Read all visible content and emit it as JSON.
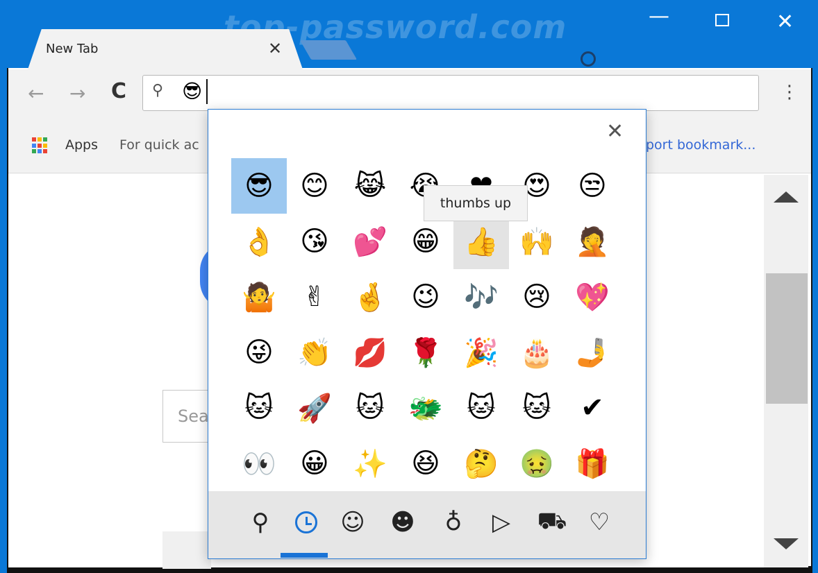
{
  "window": {
    "watermark": "top-password.com",
    "min_glyph": "—",
    "close_glyph": "✕"
  },
  "tab": {
    "title": "New Tab",
    "close_glyph": "✕"
  },
  "toolbar": {
    "back_glyph": "←",
    "forward_glyph": "→",
    "reload_glyph": "C",
    "search_glyph": "⚲",
    "omnibox_value": "😎",
    "menu_glyph": "⋮"
  },
  "bookmarks": {
    "apps_label": "Apps",
    "quick_access_text": "For quick ac",
    "import_text": "port bookmark...",
    "apps_colors": [
      "#ea4335",
      "#fbbc05",
      "#34a853",
      "#4285f4",
      "#ea4335",
      "#fbbc05",
      "#34a853",
      "#4285f4",
      "#ea4335"
    ]
  },
  "page": {
    "search_placeholder": "Sea"
  },
  "emoji_panel": {
    "close_glyph": "✕",
    "tooltip": "thumbs up",
    "selected_index": 0,
    "hovered_index": 11,
    "emojis": [
      {
        "char": "😎",
        "name": "smiling-face-with-sunglasses"
      },
      {
        "char": "😊",
        "name": "smiling-face-with-smiling-eyes"
      },
      {
        "char": "😹",
        "name": "cat-with-tears-of-joy"
      },
      {
        "char": "😭",
        "name": "loudly-crying-face"
      },
      {
        "char": "❤",
        "name": "red-heart"
      },
      {
        "char": "😍",
        "name": "smiling-face-with-heart-eyes"
      },
      {
        "char": "😒",
        "name": "unamused-face"
      },
      {
        "char": "👌",
        "name": "ok-hand"
      },
      {
        "char": "😘",
        "name": "face-blowing-a-kiss"
      },
      {
        "char": "💕",
        "name": "two-hearts"
      },
      {
        "char": "😁",
        "name": "beaming-face"
      },
      {
        "char": "👍",
        "name": "thumbs-up"
      },
      {
        "char": "🙌",
        "name": "raising-hands"
      },
      {
        "char": "🤦",
        "name": "person-facepalming"
      },
      {
        "char": "🤷",
        "name": "person-shrugging"
      },
      {
        "char": "✌",
        "name": "victory-hand"
      },
      {
        "char": "🤞",
        "name": "crossed-fingers"
      },
      {
        "char": "😉",
        "name": "winking-face"
      },
      {
        "char": "🎶",
        "name": "musical-notes"
      },
      {
        "char": "😢",
        "name": "crying-face"
      },
      {
        "char": "💖",
        "name": "sparkling-heart"
      },
      {
        "char": "😜",
        "name": "winking-face-with-tongue"
      },
      {
        "char": "👏",
        "name": "clapping-hands"
      },
      {
        "char": "💋",
        "name": "kiss-mark"
      },
      {
        "char": "🌹",
        "name": "rose"
      },
      {
        "char": "🎉",
        "name": "party-popper"
      },
      {
        "char": "🎂",
        "name": "birthday-cake"
      },
      {
        "char": "🤳",
        "name": "selfie"
      },
      {
        "char": "🐱",
        "name": "ninja-cat"
      },
      {
        "char": "🚀",
        "name": "astro-cat"
      },
      {
        "char": "🐱",
        "name": "hacker-cat"
      },
      {
        "char": "🐲",
        "name": "dino-cat"
      },
      {
        "char": "🐱",
        "name": "stack-cat"
      },
      {
        "char": "🐱",
        "name": "hipster-cat"
      },
      {
        "char": "✔",
        "name": "check-mark"
      },
      {
        "char": "👀",
        "name": "eyes"
      },
      {
        "char": "😀",
        "name": "grinning-face"
      },
      {
        "char": "✨",
        "name": "sparkles"
      },
      {
        "char": "😆",
        "name": "grinning-squinting-face"
      },
      {
        "char": "🤔",
        "name": "thinking-face"
      },
      {
        "char": "🤢",
        "name": "nauseated-face"
      },
      {
        "char": "🎁",
        "name": "wrapped-gift"
      }
    ],
    "categories": [
      {
        "glyph": "⚲",
        "name": "category-search"
      },
      {
        "glyph": "",
        "name": "category-recent"
      },
      {
        "glyph": "☺",
        "name": "category-smileys"
      },
      {
        "glyph": "☻",
        "name": "category-people"
      },
      {
        "glyph": "♁",
        "name": "category-celebration"
      },
      {
        "glyph": "▷",
        "name": "category-food"
      },
      {
        "glyph": "⛟",
        "name": "category-travel"
      },
      {
        "glyph": "♡",
        "name": "category-symbols"
      }
    ]
  }
}
